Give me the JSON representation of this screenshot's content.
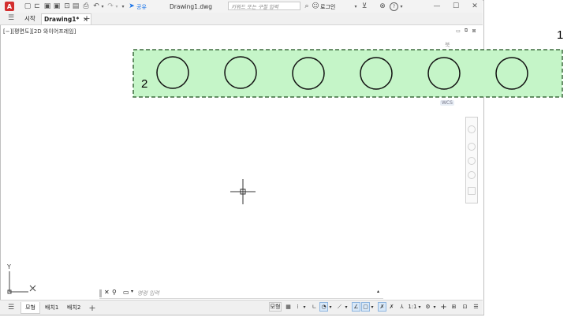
{
  "title_bar": {
    "app_logo": "A",
    "share_label": "공유",
    "file_name": "Drawing1.dwg",
    "search_placeholder": "키워드 또는 구절 입력",
    "login_label": "로그인",
    "help_label": "?"
  },
  "tabs": [
    {
      "label": "시작"
    },
    {
      "label": "Drawing1*"
    }
  ],
  "viewport_label": "[−][평면도][2D 와이어프레임]",
  "viewcube_label": "북",
  "wcs_label": "WCS",
  "command_placeholder": "명령 입력",
  "layout_tabs": [
    {
      "label": "모형"
    },
    {
      "label": "배치1"
    },
    {
      "label": "배치2"
    }
  ],
  "status": {
    "model_label": "모형",
    "scale_label": "1:1"
  },
  "annotations": {
    "label_1": "1",
    "label_2": "2",
    "highlight_color": "#c5f5c8",
    "highlight_border": "#3d6b3d"
  },
  "ucs": {
    "y_label": "Y"
  }
}
